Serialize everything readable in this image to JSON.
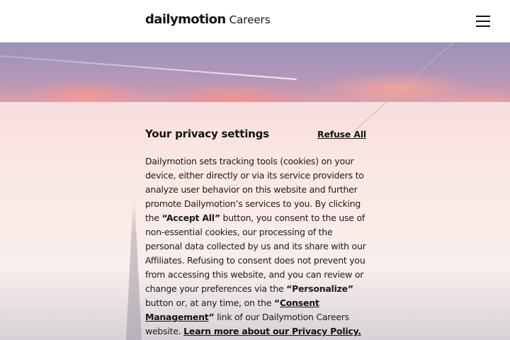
{
  "header": {
    "brand": "dailymotion",
    "suffix": "Careers",
    "menu_icon": "hamburger-menu-icon"
  },
  "privacy": {
    "title": "Your privacy settings",
    "refuse_label": "Refuse All",
    "body_1": "Dailymotion sets tracking tools (cookies) on your device, either directly or via its service providers to analyze user behavior on this website and further promote Dailymotion’s services to you. By clicking the ",
    "accept_quote": "“Accept All”",
    "body_2": " button, you consent to the use of non-essential cookies, our processing of the personal data collected by us and its share with our Affiliates. Refusing to consent does not prevent you from accessing this website, and you can review or change your preferences via the ",
    "personalize_quote": "“Personalize”",
    "body_3": " button or, at any time, on the ",
    "open_quote": "“",
    "consent_link": "Consent Management",
    "close_quote": "”",
    "body_4": " link of our Dailymotion Careers website. ",
    "learn_more_link": "Learn more about our Privacy Policy."
  }
}
